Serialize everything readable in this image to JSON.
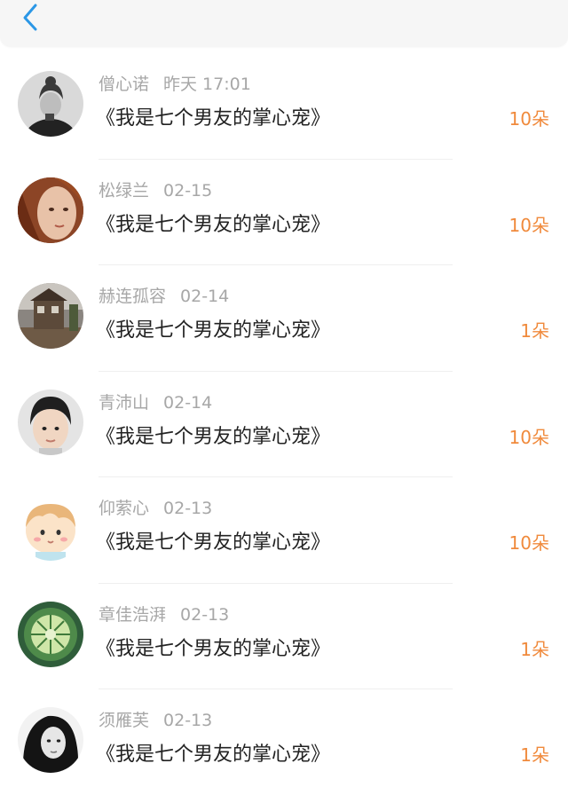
{
  "colors": {
    "accent": "#2b97e6",
    "gift": "#f08a3c",
    "meta_text": "#a7a7a7",
    "title_text": "#222222"
  },
  "header": {
    "back_icon": "chevron-left-icon"
  },
  "rows": [
    {
      "name": "僧心诺",
      "date": "昨天 17:01",
      "book": "《我是七个男友的掌心宠》",
      "gift": "10朵"
    },
    {
      "name": "松绿兰",
      "date": "02-15",
      "book": "《我是七个男友的掌心宠》",
      "gift": "10朵"
    },
    {
      "name": "赫连孤容",
      "date": "02-14",
      "book": "《我是七个男友的掌心宠》",
      "gift": "1朵"
    },
    {
      "name": "青沛山",
      "date": "02-14",
      "book": "《我是七个男友的掌心宠》",
      "gift": "10朵"
    },
    {
      "name": "仰萦心",
      "date": "02-13",
      "book": "《我是七个男友的掌心宠》",
      "gift": "10朵"
    },
    {
      "name": "章佳浩湃",
      "date": "02-13",
      "book": "《我是七个男友的掌心宠》",
      "gift": "1朵"
    },
    {
      "name": "须雁芙",
      "date": "02-13",
      "book": "《我是七个男友的掌心宠》",
      "gift": "1朵"
    }
  ]
}
